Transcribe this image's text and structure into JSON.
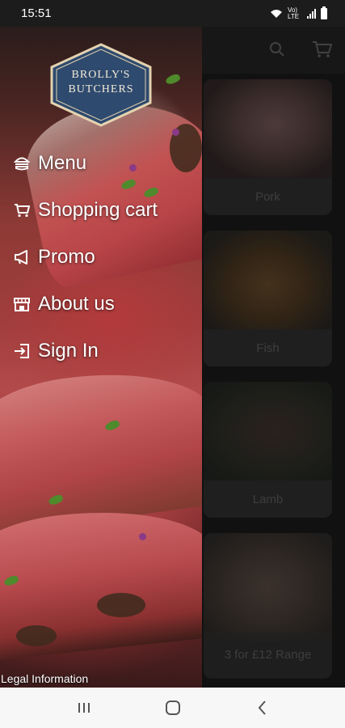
{
  "status_bar": {
    "time": "15:51",
    "network_label": "Vo) LTE",
    "wifi_icon": "wifi-icon",
    "signal_icon": "signal-icon",
    "battery_icon": "battery-icon"
  },
  "app_header": {
    "search_icon": "search-icon",
    "cart_icon": "cart-icon"
  },
  "categories": [
    {
      "label": "Pork"
    },
    {
      "label": "Fish"
    },
    {
      "label": "Lamb"
    },
    {
      "label": "3 for £12 Range"
    }
  ],
  "drawer": {
    "logo": {
      "line1": "BROLLY'S",
      "line2": "BUTCHERS"
    },
    "items": [
      {
        "label": "Menu",
        "icon": "burger-icon"
      },
      {
        "label": "Shopping cart",
        "icon": "cart-icon"
      },
      {
        "label": "Promo",
        "icon": "megaphone-icon"
      },
      {
        "label": "About us",
        "icon": "store-icon"
      },
      {
        "label": "Sign In",
        "icon": "sign-in-icon"
      }
    ],
    "legal": "Legal Information"
  },
  "nav_bar": {
    "recent_icon": "recent-apps-icon",
    "home_icon": "home-icon",
    "back_icon": "back-icon"
  },
  "colors": {
    "logo_fill": "#2e4a6e",
    "logo_border": "#e4d3b0",
    "drawer_text": "#ffffff",
    "scrim": "rgba(0,0,0,0.45)"
  }
}
